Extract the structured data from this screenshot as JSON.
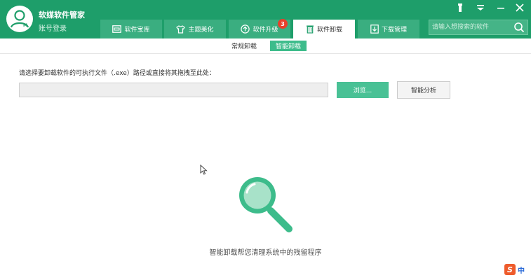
{
  "header": {
    "app_title": "软媒软件管家",
    "account_label": "账号登录",
    "brand_color": "#1e9e6a"
  },
  "window_controls": [
    "pin-icon",
    "menu-icon",
    "minimize-icon",
    "close-icon"
  ],
  "tabs": [
    {
      "label": "软件宝库",
      "icon": "store-icon"
    },
    {
      "label": "主题美化",
      "icon": "shirt-icon"
    },
    {
      "label": "软件升级",
      "icon": "upgrade-icon",
      "badge": "3"
    },
    {
      "label": "软件卸载",
      "icon": "trash-icon",
      "active": true
    },
    {
      "label": "下载管理",
      "icon": "download-icon"
    }
  ],
  "search": {
    "placeholder": "请输入想搜索的软件"
  },
  "subtabs": [
    {
      "label": "常规卸载"
    },
    {
      "label": "智能卸载",
      "active": true
    }
  ],
  "main": {
    "instruction": "请选择要卸载软件的可执行文件（.exe）路径或直接将其拖拽至此处：",
    "path_value": "",
    "browse_label": "浏览...",
    "analyze_label": "智能分析",
    "empty_text": "智能卸载帮您清理系统中的残留程序"
  },
  "ime": {
    "mode_label": "中",
    "logo_letter": "S"
  },
  "colors": {
    "accent": "#3dbc8b",
    "badge": "#e8402c"
  }
}
